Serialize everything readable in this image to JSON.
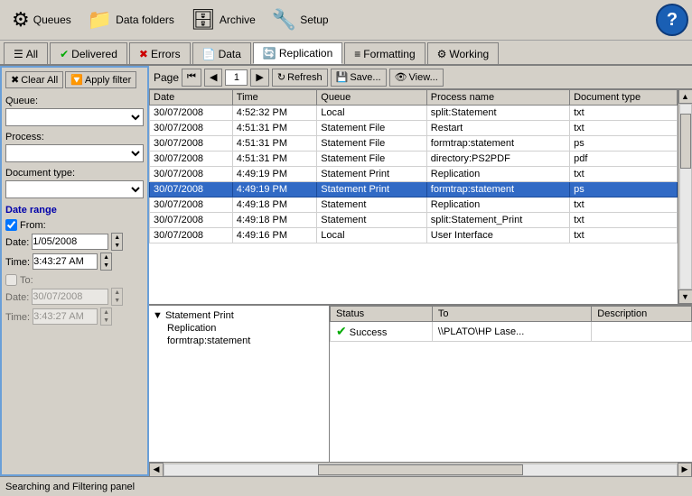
{
  "toolbar": {
    "buttons": [
      {
        "id": "queues",
        "label": "Queues",
        "icon": "⚙"
      },
      {
        "id": "data-folders",
        "label": "Data folders",
        "icon": "📁"
      },
      {
        "id": "archive",
        "label": "Archive",
        "icon": "🗄"
      },
      {
        "id": "setup",
        "label": "Setup",
        "icon": "🔧"
      }
    ],
    "help_label": "?"
  },
  "tabs1": {
    "items": [
      {
        "id": "all",
        "label": "All",
        "icon": ""
      },
      {
        "id": "delivered",
        "label": "Delivered",
        "icon": "✔",
        "icon_color": "#00aa00"
      },
      {
        "id": "errors",
        "label": "Errors",
        "icon": "✖",
        "icon_color": "#cc0000"
      },
      {
        "id": "data",
        "label": "Data",
        "icon": "📄"
      },
      {
        "id": "replication",
        "label": "Replication",
        "icon": "🔄",
        "active": true
      },
      {
        "id": "formatting",
        "label": "Formatting",
        "icon": "≡",
        "active": false
      },
      {
        "id": "working",
        "label": "Working",
        "icon": "⚙"
      }
    ]
  },
  "filter": {
    "clear_label": "Clear All",
    "apply_label": "Apply filter",
    "queue_label": "Queue:",
    "process_label": "Process:",
    "doctype_label": "Document type:",
    "date_range_label": "Date range",
    "from_label": "From:",
    "from_date": "1/05/2008",
    "from_time": "3:43:27 AM",
    "to_label": "To:",
    "to_date": "30/07/2008",
    "to_time": "3:43:27 AM",
    "date_label": "Date:",
    "time_label": "Time:"
  },
  "page_controls": {
    "page_label": "Page",
    "page_num": "1",
    "refresh_label": "Refresh",
    "save_label": "Save...",
    "view_label": "View..."
  },
  "log_table": {
    "columns": [
      "Date",
      "Time",
      "Queue",
      "Process name",
      "Document type"
    ],
    "rows": [
      {
        "date": "30/07/2008",
        "time": "4:52:32 PM",
        "queue": "Local",
        "process": "split:Statement",
        "doctype": "txt",
        "selected": false
      },
      {
        "date": "30/07/2008",
        "time": "4:51:31 PM",
        "queue": "Statement File",
        "process": "Restart",
        "doctype": "txt",
        "selected": false
      },
      {
        "date": "30/07/2008",
        "time": "4:51:31 PM",
        "queue": "Statement File",
        "process": "formtrap:statement",
        "doctype": "ps",
        "selected": false
      },
      {
        "date": "30/07/2008",
        "time": "4:51:31 PM",
        "queue": "Statement File",
        "process": "directory:PS2PDF",
        "doctype": "pdf",
        "selected": false
      },
      {
        "date": "30/07/2008",
        "time": "4:49:19 PM",
        "queue": "Statement Print",
        "process": "Replication",
        "doctype": "txt",
        "selected": false
      },
      {
        "date": "30/07/2008",
        "time": "4:49:19 PM",
        "queue": "Statement Print",
        "process": "formtrap:statement",
        "doctype": "ps",
        "selected": true
      },
      {
        "date": "30/07/2008",
        "time": "4:49:18 PM",
        "queue": "Statement",
        "process": "Replication",
        "doctype": "txt",
        "selected": false
      },
      {
        "date": "30/07/2008",
        "time": "4:49:18 PM",
        "queue": "Statement",
        "process": "split:Statement_Print",
        "doctype": "txt",
        "selected": false
      },
      {
        "date": "30/07/2008",
        "time": "4:49:16 PM",
        "queue": "Local",
        "process": "User Interface",
        "doctype": "txt",
        "selected": false
      }
    ]
  },
  "tree": {
    "items": [
      {
        "label": "Statement Print",
        "icon": "▼",
        "children": [
          {
            "label": "Replication"
          },
          {
            "label": "formtrap:statement"
          }
        ]
      }
    ]
  },
  "detail_table": {
    "columns": [
      "Status",
      "To",
      "Description"
    ],
    "rows": [
      {
        "status": "Success",
        "to": "\\\\PLATO\\HP Lase...",
        "description": ""
      }
    ]
  },
  "bottom_label": "Searching and Filtering panel",
  "colors": {
    "selected_row_bg": "#316ac5",
    "tab_active_bg": "#ffffff",
    "border": "#808080",
    "accent_blue": "#6a9fd8"
  }
}
